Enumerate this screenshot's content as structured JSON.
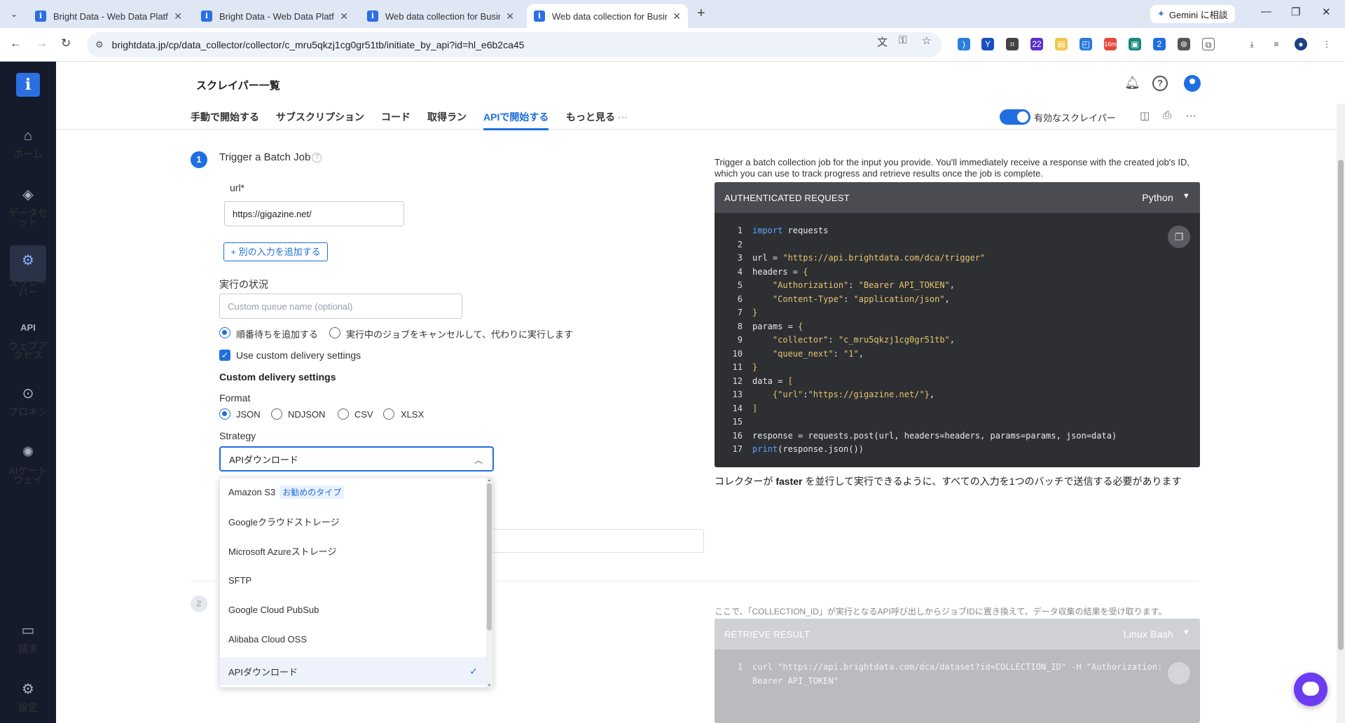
{
  "browser": {
    "tabs": [
      {
        "title": "Bright Data - Web Data Platform",
        "active": false
      },
      {
        "title": "Bright Data - Web Data Platform",
        "active": false
      },
      {
        "title": "Web data collection for Business",
        "active": false
      },
      {
        "title": "Web data collection for Business",
        "active": true
      }
    ],
    "gemini_label": "Gemini に相談",
    "url": "brightdata.jp/cp/data_collector/collector/c_mru5qkzj1cg0gr51tb/initiate_by_api?id=hl_e6b2ca45",
    "ext_badges": {
      "a": "22",
      "b": "16m",
      "c": "2"
    }
  },
  "sidebar": {
    "items": [
      {
        "label": "ホーム",
        "icon": "home-icon"
      },
      {
        "label": "データセット",
        "icon": "dataset-icon"
      },
      {
        "label": "スクレーパー",
        "icon": "scraper-icon"
      },
      {
        "label": "ウェブアクセス",
        "icon": "web-access-icon"
      },
      {
        "label": "プロキシ",
        "icon": "proxy-icon"
      },
      {
        "label": "AIゲートウェイ",
        "icon": "ai-gateway-icon"
      },
      {
        "label": "請求",
        "icon": "billing-icon"
      },
      {
        "label": "設定",
        "icon": "settings-icon"
      }
    ],
    "api_glyph": "API"
  },
  "header": {
    "title": "スクレイパー一覧"
  },
  "subnav": {
    "tabs": [
      "手動で開始する",
      "サブスクリプション",
      "コード",
      "取得ラン",
      "APIで開始する",
      "もっと見る"
    ],
    "more_dots": "⋯",
    "toggle_label": "有効なスクレイパー"
  },
  "form": {
    "step1_num": "1",
    "step2_num": "2",
    "trigger_title": "Trigger a Batch Job",
    "help": "?",
    "url_label": "url*",
    "url_value": "https://gigazine.net/",
    "add_input": "+ 別の入力を追加する",
    "status_label": "実行の状況",
    "queue_placeholder": "Custom queue name (optional)",
    "radio_queue": "順番待ちを追加する",
    "radio_cancel": "実行中のジョブをキャンセルして、代わりに実行します",
    "use_custom": "Use custom delivery settings",
    "custom_title": "Custom delivery settings",
    "format_label": "Format",
    "formats": [
      "JSON",
      "NDJSON",
      "CSV",
      "XLSX"
    ],
    "strategy_label": "Strategy",
    "strategy_value": "APIダウンロード",
    "dropdown": [
      {
        "label": "Amazon S3",
        "badge": "お勧めのタイプ"
      },
      {
        "label": "Googleクラウドストレージ"
      },
      {
        "label": "Microsoft Azureストレージ"
      },
      {
        "label": "SFTP"
      },
      {
        "label": "Google Cloud PubSub"
      },
      {
        "label": "Alibaba Cloud OSS"
      },
      {
        "label": "APIダウンロード",
        "selected": true
      }
    ]
  },
  "right": {
    "desc": "Trigger a batch collection job for the input you provide. You'll immediately receive a response with the created job's ID, which you can use to track progress and retrieve results once the job is complete.",
    "code_header": "AUTHENTICATED REQUEST",
    "code_lang": "Python",
    "code": [
      "import requests",
      "",
      "url = \"https://api.brightdata.com/dca/trigger\"",
      "headers = {",
      "    \"Authorization\": \"Bearer API_TOKEN\",",
      "    \"Content-Type\": \"application/json\",",
      "}",
      "params = {",
      "    \"collector\": \"c_mru5qkzj1cg0gr51tb\",",
      "    \"queue_next\": \"1\",",
      "}",
      "data = [",
      "    {\"url\":\"https://gigazine.net/\"},",
      "]",
      "",
      "response = requests.post(url, headers=headers, params=params, json=data)",
      "print(response.json())"
    ],
    "note_pre": "コレクターが ",
    "note_bold": "faster",
    "note_post": " を並行して実行できるように、すべての入力を1つのバッチで送信する必要があります",
    "desc2": "ここで、「COLLECTION_ID」が実行となるAPI呼び出しからジョブIDに置き換えて、データ収集の結果を受け取ります。",
    "code2_header": "RETRIEVE RESULT",
    "code2_lang": "Linux Bash",
    "code2": [
      "curl \"https://api.brightdata.com/dca/dataset?id=COLLECTION_ID\" -H \"Authorization:",
      "Bearer API_TOKEN\""
    ]
  }
}
